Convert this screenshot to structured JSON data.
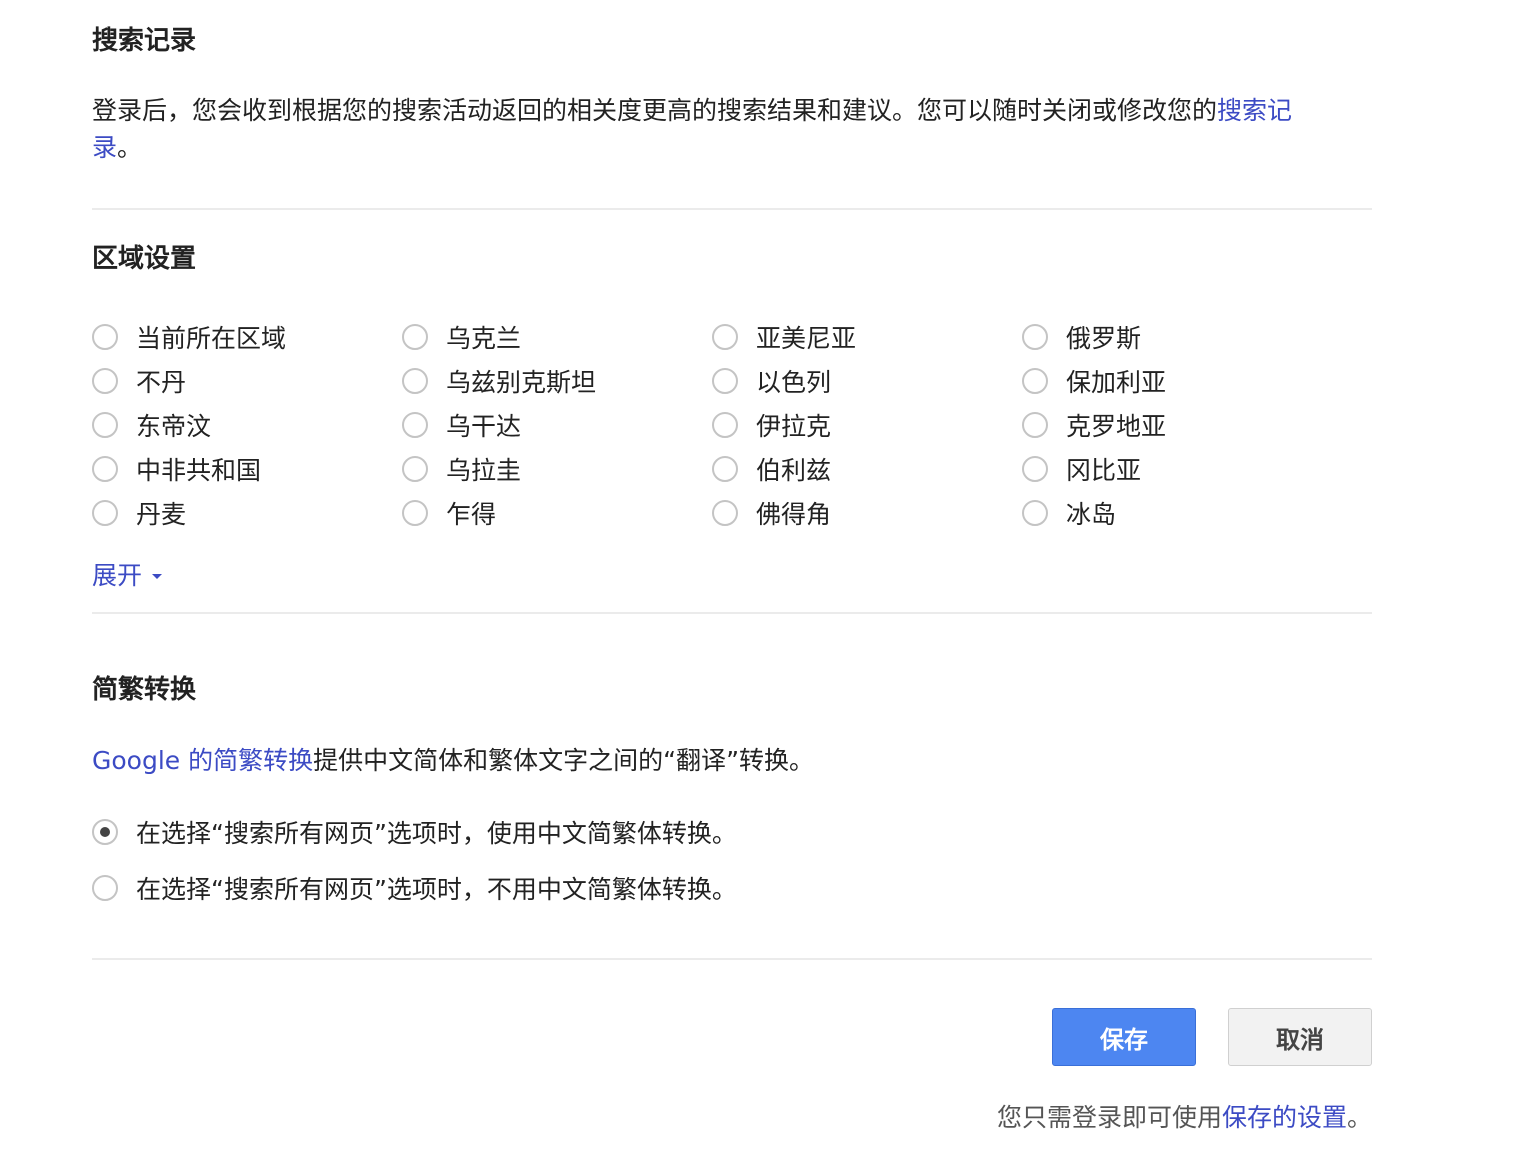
{
  "search_history": {
    "title": "搜索记录",
    "text_before": "登录后，您会收到根据您的搜索活动返回的相关度更高的搜索结果和建议。您可以随时关闭或修改您的",
    "link": "搜索记录",
    "text_after": "。"
  },
  "region": {
    "title": "区域设置",
    "columns": [
      [
        "当前所在区域",
        "不丹",
        "东帝汶",
        "中非共和国",
        "丹麦"
      ],
      [
        "乌克兰",
        "乌兹别克斯坦",
        "乌干达",
        "乌拉圭",
        "乍得"
      ],
      [
        "亚美尼亚",
        "以色列",
        "伊拉克",
        "伯利兹",
        "佛得角"
      ],
      [
        "俄罗斯",
        "保加利亚",
        "克罗地亚",
        "冈比亚",
        "冰岛"
      ]
    ],
    "expand_label": "展开"
  },
  "conversion": {
    "title": "简繁转换",
    "link": "Google 的简繁转换",
    "text_after": "提供中文简体和繁体文字之间的“翻译”转换。",
    "options": [
      {
        "label": "在选择“搜索所有网页”选项时，使用中文简繁体转换。",
        "checked": true
      },
      {
        "label": "在选择“搜索所有网页”选项时，不用中文简繁体转换。",
        "checked": false
      }
    ]
  },
  "actions": {
    "save_label": "保存",
    "cancel_label": "取消"
  },
  "footer": {
    "text_before": "您只需登录即可使用",
    "link": "保存的设置",
    "text_after": "。"
  },
  "colors": {
    "link": "#3c4bc4",
    "primary_button": "#4d86f1",
    "divider": "#ebebeb"
  }
}
